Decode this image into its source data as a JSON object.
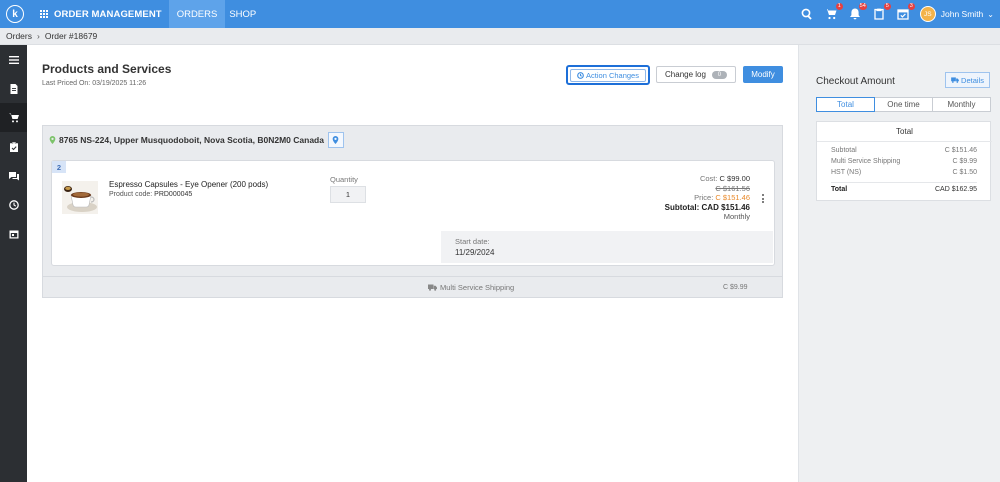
{
  "topbar": {
    "logo_letter": "k",
    "brand": "ORDER MANAGEMENT",
    "tabs": [
      {
        "label": "ORDERS"
      },
      {
        "label": "SHOP"
      }
    ],
    "badges": {
      "cart": "1",
      "bell": "54",
      "clipboard": "5",
      "calendar": "3"
    },
    "user": {
      "initials": "JS",
      "name": "John Smith"
    }
  },
  "breadcrumb": {
    "root": "Orders",
    "current": "Order #18679"
  },
  "main": {
    "title": "Products and Services",
    "last_priced": "Last Priced On: 03/19/2025 11:26",
    "buttons": {
      "action_changes": "Action Changes",
      "change_log": "Change log",
      "change_log_count": "0",
      "modify": "Modify"
    },
    "address": "8765 NS-224, Upper Musquodoboit, Nova Scotia, B0N2M0 Canada",
    "item": {
      "number": "2",
      "name": "Espresso Capsules - Eye Opener (200 pods)",
      "code_label": "Product code:",
      "code": "PRD000045",
      "quantity_label": "Quantity",
      "quantity": "1",
      "cost_label": "Cost:",
      "cost": "C $99.00",
      "original_price": "C $161.56",
      "price_label": "Price:",
      "price": "C $151.46",
      "subtotal_label": "Subtotal:",
      "subtotal": "CAD $151.46",
      "billing": "Monthly",
      "start_label": "Start date:",
      "start_date": "11/29/2024"
    },
    "shipping": {
      "label": "Multi Service Shipping",
      "price": "C $9.99"
    }
  },
  "checkout": {
    "title": "Checkout Amount",
    "details_label": "Details",
    "tabs": [
      "Total",
      "One time",
      "Monthly"
    ],
    "card_title": "Total",
    "rows": [
      {
        "label": "Subtotal",
        "value": "C $151.46"
      },
      {
        "label": "Multi Service Shipping",
        "value": "C $9.99"
      },
      {
        "label": "HST (NS)",
        "value": "C $1.50"
      }
    ],
    "total": {
      "label": "Total",
      "value": "CAD $162.95"
    }
  },
  "colors": {
    "primary": "#3f8ee0",
    "sidebar": "#2c2f33",
    "accent_orange": "#e98a2b",
    "highlight": "#1d6fd8"
  }
}
